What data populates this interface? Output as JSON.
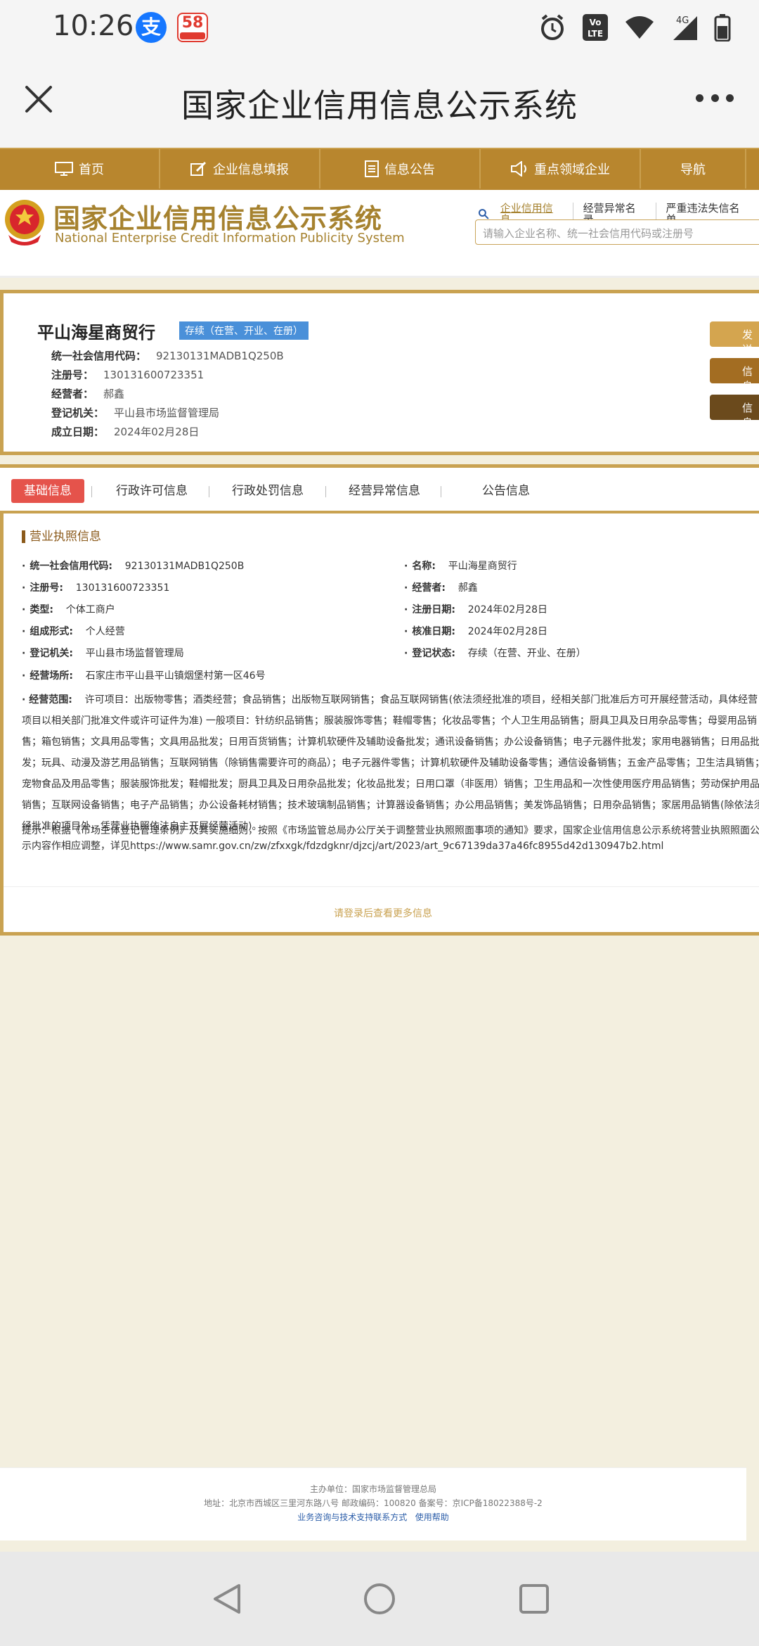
{
  "status_bar": {
    "time": "10:26",
    "alipay_icon": "支",
    "app58_icon": "58",
    "icons": [
      "alarm-icon",
      "volte-icon",
      "wifi-icon",
      "4g-signal-icon",
      "battery-icon"
    ],
    "network": "4G"
  },
  "app_bar": {
    "title": "国家企业信用信息公示系统"
  },
  "nav": {
    "items": [
      "首页",
      "企业信息填报",
      "信息公告",
      "重点领域企业",
      "导航"
    ]
  },
  "banner": {
    "title_cn": "国家企业信用信息公示系统",
    "title_en": "National Enterprise Credit Information Publicity System",
    "search_tabs": [
      "企业信用信息",
      "经营异常名录",
      "严重违法失信名单"
    ],
    "search_placeholder": "请输入企业名称、统一社会信用代码或注册号"
  },
  "company": {
    "name": "平山海星商贸行",
    "status": "存续（在营、开业、在册）",
    "rows": [
      {
        "label": "统一社会信用代码：",
        "value": "92130131MADB1Q250B"
      },
      {
        "label": "注册号：",
        "value": "130131600723351"
      },
      {
        "label": "经营者：",
        "value": "郝鑫"
      },
      {
        "label": "登记机关：",
        "value": "平山县市场监督管理局"
      },
      {
        "label": "成立日期：",
        "value": "2024年02月28日"
      }
    ],
    "side_buttons": [
      "发送",
      "信息",
      "信息"
    ]
  },
  "tabs": [
    "基础信息",
    "行政许可信息",
    "行政处罚信息",
    "经营异常信息",
    "公告信息"
  ],
  "license": {
    "section_title": "营业执照信息",
    "left": [
      {
        "label": "统一社会信用代码:",
        "value": "92130131MADB1Q250B"
      },
      {
        "label": "注册号:",
        "value": "130131600723351"
      },
      {
        "label": "类型:",
        "value": "个体工商户"
      },
      {
        "label": "组成形式:",
        "value": "个人经营"
      },
      {
        "label": "登记机关:",
        "value": "平山县市场监督管理局"
      }
    ],
    "right": [
      {
        "label": "名称:",
        "value": "平山海星商贸行"
      },
      {
        "label": "经营者:",
        "value": "郝鑫"
      },
      {
        "label": "注册日期:",
        "value": "2024年02月28日"
      },
      {
        "label": "核准日期:",
        "value": "2024年02月28日"
      },
      {
        "label": "登记状态:",
        "value": "存续（在营、开业、在册）"
      }
    ],
    "address_label": "经营场所:",
    "address": "石家庄市平山县平山镇烟堡村第一区46号",
    "scope_label": "经营范围:",
    "scope": "许可项目：出版物零售；酒类经营；食品销售；出版物互联网销售；食品互联网销售(依法须经批准的项目，经相关部门批准后方可开展经营活动，具体经营项目以相关部门批准文件或许可证件为准) 一般项目：针纺织品销售；服装服饰零售；鞋帽零售；化妆品零售；个人卫生用品销售；厨具卫具及日用杂品零售；母婴用品销售；箱包销售；文具用品零售；文具用品批发；日用百货销售；计算机软硬件及辅助设备批发；通讯设备销售；办公设备销售；电子元器件批发；家用电器销售；日用品批发；玩具、动漫及游艺用品销售；互联网销售（除销售需要许可的商品）；电子元器件零售；计算机软硬件及辅助设备零售；通信设备销售；五金产品零售；卫生洁具销售；宠物食品及用品零售；服装服饰批发；鞋帽批发；厨具卫具及日用杂品批发；化妆品批发；日用口罩（非医用）销售；卫生用品和一次性使用医疗用品销售；劳动保护用品销售；互联网设备销售；电子产品销售；办公设备耗材销售；技术玻璃制品销售；计算器设备销售；办公用品销售；美发饰品销售；日用杂品销售；家居用品销售(除依法须经批准的项目外，凭营业执照依法自主开展经营活动)。",
    "tip": "提示：根据《市场主体登记管理条例》及其实施细则，按照《市场监管总局办公厅关于调整营业执照照面事项的通知》要求，国家企业信用信息公示系统将营业执照照面公示内容作相应调整，详见https://www.samr.gov.cn/zw/zfxxgk/fdzdgknr/djzcj/art/2023/art_9c67139da37a46fc8955d42d130947b2.html",
    "login_more": "请登录后查看更多信息"
  },
  "footer": {
    "line1": "主办单位：国家市场监督管理总局",
    "line2": "地址：北京市西城区三里河东路八号   邮政编码：100820   备案号：京ICP备18022388号-2",
    "link1": "业务咨询与技术支持联系方式",
    "link2": "使用帮助"
  },
  "colors": {
    "gold": "#c9a251",
    "nav_bg": "#b8862e",
    "status_blue": "#4a90d9",
    "active_tab": "#e5534b"
  }
}
